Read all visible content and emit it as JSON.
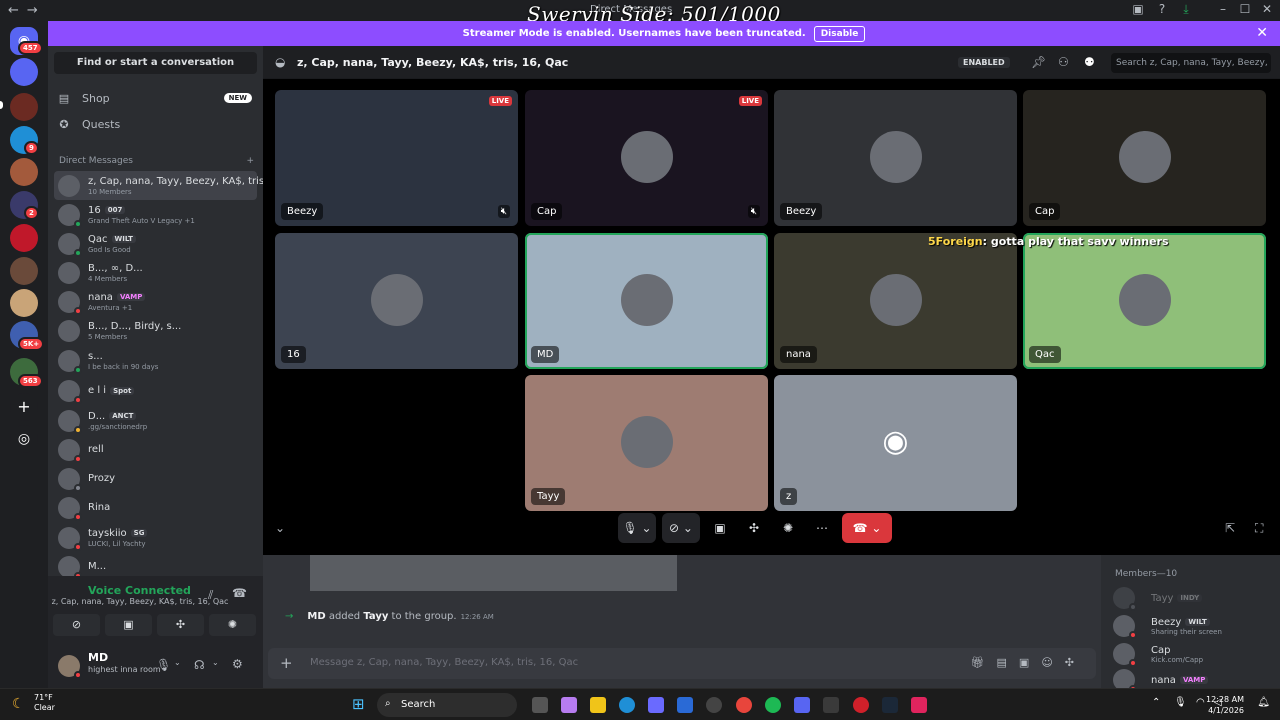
{
  "window": {
    "title": "Direct Messages",
    "overlay_text": "Swervin Side: 501/1000"
  },
  "banner": {
    "text": "Streamer Mode is enabled. Usernames have been truncated.",
    "button": "Disable"
  },
  "rail": {
    "home_badge": "457",
    "badges": [
      "9",
      "2",
      "5K+",
      "563"
    ]
  },
  "sidebar": {
    "find_button": "Find or start a conversation",
    "nav": [
      {
        "label": "Shop",
        "badge": "NEW",
        "icon": "shop-icon"
      },
      {
        "label": "Quests",
        "icon": "quests-icon"
      }
    ],
    "dm_header": "Direct Messages",
    "dms": [
      {
        "name": "z, Cap, nana, Tayy, Beezy, KA$, tris...",
        "sub": "10 Members",
        "selected": true,
        "status": ""
      },
      {
        "name": "16",
        "tag": "007",
        "sub": "Grand Theft Auto V Legacy +1",
        "status": "#23a55a"
      },
      {
        "name": "Qac",
        "tag": "WILT",
        "sub": "God Is Good",
        "status": "#23a55a"
      },
      {
        "name": "B..., ∞, D...",
        "sub": "4 Members",
        "status": ""
      },
      {
        "name": "nana",
        "tag": "VAMP",
        "sub": "Aventura +1",
        "status": "#f23f43"
      },
      {
        "name": "B..., D..., Birdy, s...",
        "sub": "5 Members",
        "status": ""
      },
      {
        "name": "s...",
        "sub": "I be back in 90 days",
        "status": "#23a55a"
      },
      {
        "name": "e l i",
        "tag": "Spot",
        "sub": "",
        "status": "#f23f43"
      },
      {
        "name": "D...",
        "tag": "ANCT",
        "sub": ".gg/sanctionedrp",
        "status": "#f0b232"
      },
      {
        "name": "rell",
        "sub": "",
        "status": "#f23f43"
      },
      {
        "name": "Prozy",
        "sub": "",
        "status": "#80848e"
      },
      {
        "name": "Rina",
        "sub": "",
        "status": "#f23f43"
      },
      {
        "name": "tayskiio",
        "tag": "SG",
        "sub": "LUCKI, Lil Yachty",
        "status": "#f23f43"
      },
      {
        "name": "M...",
        "sub": "",
        "status": "#f23f43"
      }
    ]
  },
  "voice": {
    "status": "Voice Connected",
    "channel": "z, Cap, nana, Tayy, Beezy, KA$, tris, 16, Qac"
  },
  "user": {
    "name": "MD",
    "status": "highest inna room"
  },
  "header": {
    "title": "z, Cap, nana, Tayy, Beezy, KA$, tris, 16, Qac",
    "enabled_label": "ENABLED",
    "search_placeholder": "Search z, Cap, nana, Tayy, Beezy, ..."
  },
  "tiles": [
    {
      "name": "Beezy",
      "live": "LIVE",
      "bg": "#2c3340"
    },
    {
      "name": "Cap",
      "live": "LIVE",
      "bg": "#1a1420"
    },
    {
      "name": "Beezy",
      "bg": "#303236"
    },
    {
      "name": "Cap",
      "bg": "#26241f"
    },
    {
      "name": "16",
      "bg": "#3d4451"
    },
    {
      "name": "MD",
      "bg": "#9fb1c0",
      "speaking": true
    },
    {
      "name": "nana",
      "bg": "#3b3a2f"
    },
    {
      "name": "Qac",
      "bg": "#8fbf79",
      "speaking": true
    },
    {
      "name": "Tayy",
      "bg": "#9e7c72"
    },
    {
      "name": "z",
      "bg": "#8b929c"
    }
  ],
  "chat_overlay": {
    "user": "5Foreign",
    "message": ": gotta play that savv winners"
  },
  "chat": {
    "actor": "MD",
    "verb": " added ",
    "target": "Tayy",
    "rest": " to the group.",
    "time": "12:26 AM",
    "composer_placeholder": "Message z, Cap, nana, Tayy, Beezy, KA$, tris, 16, Qac"
  },
  "members": {
    "header": "Members—10",
    "list": [
      {
        "name": "Tayy",
        "tag": "INDY",
        "sub": "",
        "status": "#80848e",
        "dim": true
      },
      {
        "name": "Beezy",
        "tag": "WILT",
        "sub": "Sharing their screen",
        "status": "#f23f43"
      },
      {
        "name": "Cap",
        "sub": "Kick.com/Capp",
        "status": "#f23f43"
      },
      {
        "name": "nana",
        "tag": "VAMP",
        "sub": "",
        "status": "#f23f43"
      }
    ]
  },
  "taskbar": {
    "temp": "71°F",
    "weather": "Clear",
    "search": "Search",
    "time": "12:28 AM",
    "date": "4/1/2026"
  }
}
